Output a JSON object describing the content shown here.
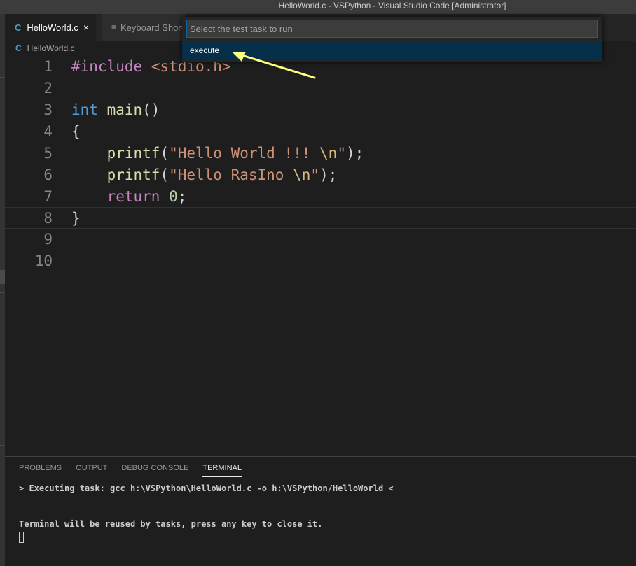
{
  "window": {
    "title": "HelloWorld.c - VSPython - Visual Studio Code [Administrator]"
  },
  "tabs": [
    {
      "icon": "C",
      "label": "HelloWorld.c",
      "close": "×"
    },
    {
      "icon": "≡",
      "label": "Keyboard Shortcuts"
    }
  ],
  "breadcrumb": {
    "icon": "C",
    "label": "HelloWorld.c"
  },
  "editor": {
    "line_numbers": [
      "1",
      "2",
      "3",
      "4",
      "5",
      "6",
      "7",
      "8",
      "9",
      "10"
    ],
    "lines": {
      "l1": {
        "directive": "#include",
        "header": " <stdio.h>"
      },
      "l3": {
        "type": "int",
        "name": " main",
        "parens": "()"
      },
      "l4": {
        "text": "{"
      },
      "l5": {
        "indent": "    ",
        "fn": "printf",
        "open": "(",
        "str": "\"Hello World !!! ",
        "esc": "\\n",
        "strend": "\"",
        "close": ");"
      },
      "l6": {
        "indent": "    ",
        "fn": "printf",
        "open": "(",
        "str": "\"Hello RasIno ",
        "esc": "\\n",
        "strend": "\"",
        "close": ");"
      },
      "l7": {
        "indent": "    ",
        "kw": "return",
        "space": " ",
        "num": "0",
        "semi": ";"
      },
      "l8": {
        "text": "}"
      }
    }
  },
  "quick_pick": {
    "placeholder": "Select the test task to run",
    "items": [
      "execute"
    ]
  },
  "panel": {
    "tabs": [
      "PROBLEMS",
      "OUTPUT",
      "DEBUG CONSOLE",
      "TERMINAL"
    ],
    "active_tab": "TERMINAL",
    "terminal_lines": [
      "> Executing task: gcc h:\\VSPython\\HelloWorld.c -o h:\\VSPython/HelloWorld <",
      "Terminal will be reused by tasks, press any key to close it."
    ]
  },
  "colors": {
    "accent": "#0e639c",
    "selection": "#062f4a",
    "annotation_arrow": "#ffff80"
  }
}
